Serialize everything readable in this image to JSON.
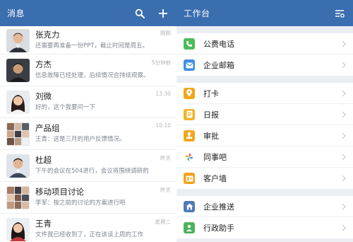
{
  "messages_header": {
    "title": "消息"
  },
  "messages": [
    {
      "name": "张克力",
      "preview": "还需要再准备一份PPT，截止时间是周五。",
      "time": "刚刚"
    },
    {
      "name": "方杰",
      "preview": "信息故障已经处理，后续情况合持续观察。",
      "time": "5分钟前"
    },
    {
      "name": "刘微",
      "preview": "好的，这个我要问一下",
      "time": "13:30"
    },
    {
      "name": "产品组",
      "preview": "王青：这是三月的用户反馈情况。",
      "time": "10:10"
    },
    {
      "name": "杜超",
      "preview": "下午的会议在504进行，会议将围绕调研的",
      "time": "昨天"
    },
    {
      "name": "移动项目讨论",
      "preview": "李军：按之前的讨论的方案进行吧",
      "time": "昨天"
    },
    {
      "name": "王青",
      "preview": "文件我已经收到了，正在该读上周的工作",
      "time": "星期二"
    }
  ],
  "workbench_header": {
    "title": "工作台"
  },
  "workbench_sections": [
    [
      {
        "label": "公费电话",
        "icon": "phone-icon",
        "color": "#4cbc5b"
      },
      {
        "label": "企业邮箱",
        "icon": "mail-icon",
        "color": "#3d8de0"
      }
    ],
    [
      {
        "label": "打卡",
        "icon": "location-pin-icon",
        "color": "#f1a51c"
      },
      {
        "label": "日报",
        "icon": "document-icon",
        "color": "#f0b424"
      },
      {
        "label": "审批",
        "icon": "approval-stamp-icon",
        "color": "#f2a71f"
      },
      {
        "label": "同事吧",
        "icon": "pinwheel-icon",
        "color": "#ffffff"
      },
      {
        "label": "客户墙",
        "icon": "contact-card-icon",
        "color": "#f2a21c"
      }
    ],
    [
      {
        "label": "企业推送",
        "icon": "home-icon",
        "color": "#4f79b8"
      },
      {
        "label": "行政助手",
        "icon": "assistant-icon",
        "color": "#4cb35c"
      }
    ]
  ],
  "colors": {
    "header_bg": "#3a6eaf",
    "list_bg": "#ffffff",
    "workbench_bg": "#ebeef3"
  }
}
